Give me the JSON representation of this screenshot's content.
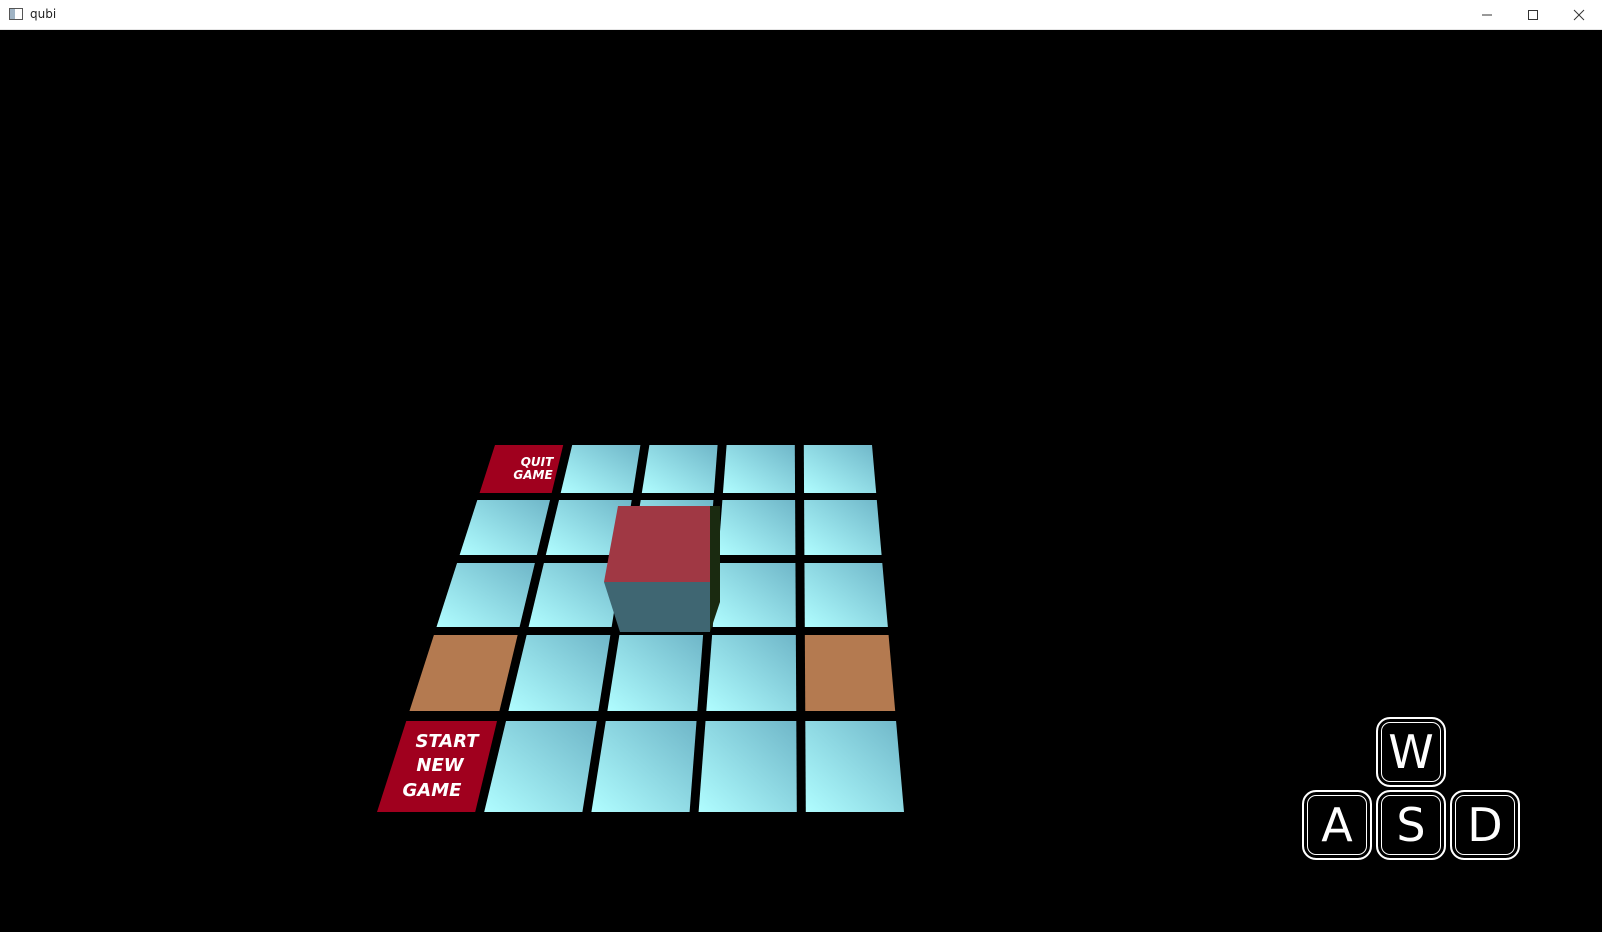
{
  "window": {
    "title": "qubi",
    "controls": {
      "minimize_icon": "minimize-icon",
      "maximize_icon": "maximize-icon",
      "close_icon": "close-icon"
    }
  },
  "board": {
    "rows": 5,
    "cols": 5,
    "tiles": {
      "quit_label_line1": "QUIT",
      "quit_label_line2": "GAME",
      "start_label_line1": "START",
      "start_label_line2": "NEW",
      "start_label_line3": "GAME"
    },
    "colors": {
      "tile_light": "#a8f4fb",
      "tile_dark": "#77bfd0",
      "menu_tile": "#a0001e",
      "goal_tile": "#b47a50",
      "cube_top": "#a03844",
      "cube_front": "#3f6672",
      "cube_side": "#1a2a10"
    }
  },
  "controls_hint": {
    "keys": [
      "W",
      "A",
      "S",
      "D"
    ]
  }
}
